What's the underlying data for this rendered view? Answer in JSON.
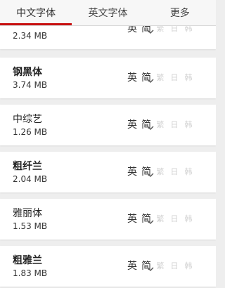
{
  "tabs": [
    {
      "label": "中文字体",
      "active": true
    },
    {
      "label": "英文字体",
      "active": false
    },
    {
      "label": "更多",
      "active": false
    }
  ],
  "fonts": [
    {
      "name": "",
      "size": "2.34 MB",
      "bold": false
    },
    {
      "name": "钢黑体",
      "size": "3.74 MB",
      "bold": true
    },
    {
      "name": "中综艺",
      "size": "1.26 MB",
      "bold": false
    },
    {
      "name": "粗纤兰",
      "size": "2.04 MB",
      "bold": true
    },
    {
      "name": "雅丽体",
      "size": "1.53 MB",
      "bold": false
    },
    {
      "name": "粗雅兰",
      "size": "1.83 MB",
      "bold": true
    }
  ],
  "styles": {
    "english": "英",
    "simplified": "简",
    "traditional": "繁",
    "japanese": "日",
    "korean": "韩"
  },
  "colors": {
    "accent": "#c81010"
  }
}
